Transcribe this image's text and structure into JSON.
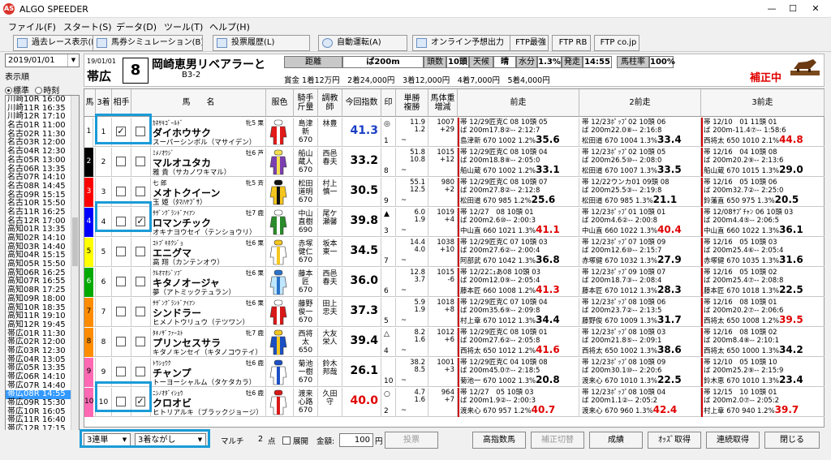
{
  "titlebar": {
    "app_icon": "AS",
    "title": "ALGO SPEEDER",
    "minimize": "—",
    "maximize": "☐",
    "close": "✕"
  },
  "menu": [
    "ファイル(F)",
    "スタート(S)",
    "データ(D)",
    "ツール(T)",
    "ヘルプ(H)"
  ],
  "toolbar": [
    {
      "label": "過去レース表示(K)",
      "icon": "magnifier-icon"
    },
    {
      "label": "馬券シミュレーション(B)",
      "icon": "simulation-icon"
    },
    {
      "label": "投票履歴(L)",
      "icon": "history-icon"
    },
    {
      "label": "自動運転(A)",
      "icon": "autorun-icon"
    },
    {
      "label": "オンライン予想出力",
      "icon": "online-icon"
    },
    {
      "label": "FTP最強",
      "icon": ""
    },
    {
      "label": "FTP RB",
      "icon": ""
    },
    {
      "label": "FTP co.jp",
      "icon": ""
    }
  ],
  "left": {
    "date": "2019/01/01",
    "order_label": "表示順",
    "order_options": [
      "標準",
      "時刻"
    ],
    "order_selected": 0,
    "races": [
      "川崎10R 16:00",
      "川崎11R 16:35",
      "川崎12R 17:10",
      "名古01R 11:00",
      "名古02R 11:30",
      "名古03R 12:00",
      "名古04R 12:30",
      "名古05R 13:00",
      "名古06R 13:35",
      "名古07R 14:10",
      "名古08R 14:45",
      "名古09R 15:15",
      "名古10R 15:50",
      "名古11R 16:25",
      "名古12R 17:00",
      "高知01R 13:35",
      "高知02R 14:10",
      "高知03R 14:40",
      "高知04R 15:15",
      "高知05R 15:50",
      "高知06R 16:25",
      "高知07R 16:55",
      "高知08R 17:25",
      "高知09R 18:00",
      "高知10R 18:35",
      "高知11R 19:10",
      "高知12R 19:45",
      "帯広01R 11:30",
      "帯広02R 12:00",
      "帯広03R 12:30",
      "帯広04R 13:05",
      "帯広05R 13:35",
      "帯広06R 14:10",
      "帯広07R 14:40",
      "帯広08R 14:55",
      "帯広09R 15:30",
      "帯広10R 16:05",
      "帯広11R 16:40",
      "帯広12R 17:15"
    ],
    "selected": 34
  },
  "race": {
    "date": "19/01/01",
    "venue": "帯広",
    "number": "8",
    "name": "岡崎恵男リベアラーと",
    "class": "B3-2",
    "distance_label": "距離",
    "distance": "ば200m",
    "heads_label": "頭数",
    "heads": "10頭",
    "weather_label": "天候",
    "weather": "晴",
    "moisture_label": "水分",
    "moisture": "1.3%",
    "start_label": "発走",
    "start": "14:55",
    "horse_rate_label": "馬柱率",
    "horse_rate": "100%",
    "prize": "賞金 1着12万円　2着24,000円　3着12,000円　4着7,000円　5着4,000円",
    "hosei": "補正中"
  },
  "columns": [
    "馬",
    "3着",
    "相手",
    "馬　　名",
    "服色",
    "騎手\n斤量",
    "調教\n師",
    "今回指数",
    "印",
    "単勝\n複勝",
    "馬体重\n増減",
    "前走",
    "2前走",
    "3前走"
  ],
  "horses": [
    {
      "gate_color": "#ffffff",
      "no": "1",
      "idx": "1",
      "c3": true,
      "partner": false,
      "sire": "ｶﾈｻｷｺﾞｰﾙﾄﾞ",
      "name": "ダイホウサク",
      "dam": "スーパーシンボル（マサイデン）",
      "sexage": "牝5 栗",
      "silk": "red",
      "jockey": "島津\n新\n670",
      "trainer": "林豊",
      "index": "41.3",
      "index_color": "#1a3fc4",
      "mark": "◎",
      "pop": "1",
      "odds": "11.9\n1.2",
      "weight": "1007\n+29",
      "p1": [
        "帯 12/29匠克C 08 10頭 05",
        "ば 200m17.8②-- 2:12:7",
        "島津新 670 1002 1.2%35.6"
      ],
      "p2": [
        "帯 12/23ﾎﾟｯﾌﾟ02 10頭 06",
        "ば 200m22.0⑧-- 2:16:8",
        "松田道 670 1004 1.3%33.4"
      ],
      "p3": [
        "帯 12/10　01 11頭 01",
        "ば 200m-11.4⑦-- 1:58:6",
        "西将太 650 1010 2.1%44.8"
      ]
    },
    {
      "gate_color": "#000000",
      "no": "2",
      "idx": "2",
      "c3": false,
      "partner": false,
      "sire": "ﾐﾒﾉｵｳｼﾞ",
      "name": "マルオユタカ",
      "dam": "雅 貴（サカノワキマル）",
      "sexage": "牡6 芦",
      "silk": "purple",
      "jockey": "船山\n蔵人\n670",
      "trainer": "西邑\n春夫",
      "index": "33.2",
      "index_color": "#000000",
      "mark": "",
      "pop": "8",
      "odds": "51.8\n10.8",
      "weight": "1015\n+12",
      "p1": [
        "帯 12/29匠克C 08 10頭 04",
        "ば 200m18.8⑧-- 2:05:0",
        "船山蔵 670 1002 1.2%33.1"
      ],
      "p2": [
        "帯 12/23ﾎﾟｯﾌﾟ02 10頭 05",
        "ば 200m26.5⑩-- 2:08:0",
        "松田道 670 1007 1.3%33.5"
      ],
      "p3": [
        "帯 12/16　04 10頭 08",
        "ば 200m20.2⑨-- 2:13:6",
        "船山蔵 670 1015 1.3%29.0"
      ]
    },
    {
      "gate_color": "#ff0000",
      "no": "3",
      "idx": "3",
      "c3": false,
      "partner": false,
      "sire": "七 郎",
      "name": "メオトクイーン",
      "dam": "玉 姫（ﾀﾏﾊﾔﾌﾞｻ）",
      "sexage": "牝5 斉",
      "silk": "yellow",
      "jockey": "松田\n道明\n670",
      "trainer": "村上\n慎一",
      "index": "30.5",
      "index_color": "#000000",
      "mark": "",
      "pop": "9",
      "odds": "55.1\n12.5",
      "weight": "980\n+2",
      "p1": [
        "帯 12/29匠克C 08 10頭 07",
        "ば 200m27.8②-- 2:12:8",
        "松田道 670 985 1.2%25.6"
      ],
      "p2": [
        "帯 12/22ウンカ01 09頭 08",
        "ば 200m25.5③-- 2:19:8",
        "松田道 670 985 1.3%21.1"
      ],
      "p3": [
        "帯 12/16　05 10頭 06",
        "ば 200m32.7②-- 2:25:0",
        "鈴藩直 650 975 1.3%20.5"
      ]
    },
    {
      "gate_color": "#0000ff",
      "no": "4",
      "idx": "4",
      "c3": false,
      "partner": true,
      "sire": "ｻｻﾞﾝｸﾞﾗﾝﾄﾞｱｲｱﾝ",
      "name": "ロマンチック",
      "dam": "オキナヨウセイ（テンショウリ）",
      "sexage": "牡7 鹿",
      "silk": "green",
      "jockey": "中山\n直樹\n690",
      "trainer": "尾ケ\n瀬馨",
      "index": "39.8",
      "index_color": "#000000",
      "mark": "▲",
      "pop": "3",
      "odds": "6.0\n1.9",
      "weight": "1019\n+4",
      "p1": [
        "帯 12/27　08 10頭 01",
        "ば 200m2.6⑩-- 2:00:3",
        "中山直 660 1021 1.3%41.1"
      ],
      "p2": [
        "帯 12/23ﾎﾟｯﾌﾟ01 10頭 01",
        "ば 200m4.6②-- 2:00:8",
        "中山直 660 1022 1.3%40.4"
      ],
      "p3": [
        "帯 12/08ｻﾌﾟﾁｬﾝ 06 10頭 03",
        "ば 200m4.4⑤-- 2:06:5",
        "中山直 660 1022 1.3%36.1"
      ]
    },
    {
      "gate_color": "#ffff00",
      "no": "5",
      "idx": "5",
      "c3": false,
      "partner": false,
      "sire": "ｺﾄﾌﾞｷﾎｸｼﾞｮ",
      "name": "エニグマ",
      "dam": "高 翔（カンテンオウ）",
      "sexage": "牡6 栗",
      "silk": "white",
      "jockey": "赤塚\n健仁\n670",
      "trainer": "坂本\n東一",
      "index": "34.5",
      "index_color": "#000000",
      "mark": "",
      "pop": "7",
      "odds": "14.4\n4.0",
      "weight": "1038\n+10",
      "p1": [
        "帯 12/29匠克C 07 10頭 03",
        "ば 200m27.6②-- 2:00:4",
        "阿部武 670 1042 1.3%36.8"
      ],
      "p2": [
        "帯 12/23ﾎﾟｯﾌﾟ07 10頭 09",
        "ば 200m12.6⑩-- 2:15:7",
        "赤塚健 670 1032 1.3%27.9"
      ],
      "p3": [
        "帯 12/16　05 10頭 03",
        "ば 200m25.4⑥-- 2:05:4",
        "赤塚健 670 1035 1.3%31.6"
      ]
    },
    {
      "gate_color": "#00aa00",
      "no": "6",
      "idx": "6",
      "c3": false,
      "partner": false,
      "sire": "ｸﾙｵﾏｵｼﾞｿﾌﾞ",
      "name": "キタノオージャ",
      "dam": "夢（アトミックテュラン）",
      "sexage": "牡6 栗",
      "silk": "lightblue",
      "jockey": "藤本\n匠\n670",
      "trainer": "西邑\n春夫",
      "index": "36.0",
      "index_color": "#000000",
      "mark": "",
      "pop": "6",
      "odds": "12.8\n3.7",
      "weight": "1015\n-6",
      "p1": [
        "帯 12/22ﾆｭあ08 10頭 03",
        "ば 200m12.0⑨-- 2:05:4",
        "藤本匠 660 1008 1.2%41.3"
      ],
      "p2": [
        "帯 12/23ﾎﾟｯﾌﾟ09 10頭 07",
        "ば 200m18.7③-- 2:08:4",
        "藤本匠 670 1012 1.3%28.3"
      ],
      "p3": [
        "帯 12/16　05 10頭 02",
        "ば 200m25.4⑦-- 2:08:8",
        "藤本匠 670 1018 1.3%22.5"
      ]
    },
    {
      "gate_color": "#ff8c00",
      "no": "7",
      "idx": "7",
      "c3": false,
      "partner": false,
      "sire": "ｻｻﾞﾝｸﾞﾗﾝﾄﾞｱｲｱﾝ",
      "name": "シンドラー",
      "dam": "ヒメノトウリュウ（テツワン）",
      "sexage": "牡6 栗",
      "silk": "red2",
      "jockey": "藤野\n俊一\n670",
      "trainer": "田上\n忠夫",
      "index": "37.3",
      "index_color": "#000000",
      "mark": "",
      "pop": "5",
      "odds": "5.9\n1.9",
      "weight": "1018\n+8",
      "p1": [
        "帯 12/29匠克C 07 10頭 04",
        "ば 200m35.6⑨-- 2:09:8",
        "村上章 670 1012 1.3%34.4"
      ],
      "p2": [
        "帯 12/23ﾎﾟｯﾌﾟ08 10頭 06",
        "ば 200m23.7②-- 2:13:5",
        "藤野俊 670 1009 1.3%31.7"
      ],
      "p3": [
        "帯 12/16　08 10頭 01",
        "ば 200m20.2⑦-- 2:06:6",
        "西将太 650 1008 1.2%39.5"
      ]
    },
    {
      "gate_color": "#ff8c00",
      "no": "8",
      "idx": "8",
      "c3": false,
      "partner": false,
      "sire": "ﾀｷﾉｻﾞﾌｧｰｽﾄ",
      "name": "プリンセスサラ",
      "dam": "キタノキンセイ（キタノコウテイ）",
      "sexage": "牝7 鹿",
      "silk": "blue",
      "jockey": "西将\n太\n650",
      "trainer": "大友\n栄人",
      "index": "39.4",
      "index_color": "#000000",
      "mark": "△",
      "pop": "4",
      "odds": "8.2\n1.6",
      "weight": "1012\n+6",
      "p1": [
        "帯 12/29匠克C 08 10頭 01",
        "ば 200m27.6②-- 2:05:8",
        "西将太 650 1012 1.2%41.6"
      ],
      "p2": [
        "帯 12/23ﾎﾟｯﾌﾟ08 10頭 03",
        "ば 200m21.8⑤-- 2:09:1",
        "西将太 650 1002 1.3%38.6"
      ],
      "p3": [
        "帯 12/16　08 10頭 02",
        "ば 200m8.4⑧-- 2:10:1",
        "西将太 650 1000 1.3%34.2"
      ]
    },
    {
      "gate_color": "#ff69b4",
      "no": "9",
      "idx": "9",
      "c3": false,
      "partner": false,
      "sire": "ﾄｳｼｮｳｸ",
      "name": "チャンプ",
      "dam": "トーヨーシャルム（タケタカラ）",
      "sexage": "牡6 鹿",
      "silk": "bluewhite",
      "jockey": "菊池\n一樹\n670",
      "trainer": "鈴木\n邦哉",
      "index": "26.1",
      "index_color": "#000000",
      "mark": "",
      "pop": "10",
      "odds": "38.2\n8.5",
      "weight": "1001\n+3",
      "p1": [
        "帯 12/29匠克C 04 10頭 08",
        "ば 200m45.0⑦-- 2:18:5",
        "菊池一 670 1002 1.3%20.8"
      ],
      "p2": [
        "帯 12/23ﾎﾟｯﾌﾟ08 10頭 09",
        "ば 200m30.1⑩-- 2:20:6",
        "渡来心 670 1010 1.3%22.5"
      ],
      "p3": [
        "帯 12/10　05 10頭 10",
        "ば 200m25.2⑨-- 2:15:9",
        "鈴木恵 670 1010 1.3%23.4"
      ]
    },
    {
      "gate_color": "#ff69b4",
      "no": "10",
      "idx": "10",
      "c3": false,
      "partner": true,
      "sire": "ﾆｼﾉｵﾀﾞｲｼｮｳ",
      "name": "クロオビ",
      "dam": "ヒトリアルキ（ブラックジョージ）",
      "sexage": "牡6 鹿",
      "silk": "redwhite",
      "jockey": "渡来\n心路\n670",
      "trainer": "久田\n守",
      "index": "40.0",
      "index_color": "#e00000",
      "mark": "○",
      "pop": "2",
      "odds": "4.7\n1.6",
      "weight": "964\n+7",
      "p1": [
        "帯 12/27　05 10頭 03",
        "ば 200m1.9②-- 2:00:3",
        "渡来心 670 957 1.2%40.7"
      ],
      "p2": [
        "帯 12/23ﾎﾟｯﾌﾟ08 10頭 04",
        "ば 200m1.1②-- 2:05:2",
        "渡来心 670 960 1.3%42.4"
      ],
      "p3": [
        "帯 12/15　10 10頭 01",
        "ば 200m2.0⑦-- 2:05:2",
        "村上章 670 940 1.2%39.7"
      ]
    }
  ],
  "bottom": {
    "bet_type": "3連単",
    "bet_method": "3着ながし",
    "multi_label": "マルチ",
    "points": "2",
    "points_unit": "点",
    "expand_label": "展開",
    "amount_label": "金額:",
    "amount": "100",
    "amount_unit": "円",
    "vote": "投票",
    "buttons": [
      "高指数馬",
      "補正切替",
      "成績",
      "ｵｯｽﾞ取得",
      "連続取得",
      "閉じる"
    ]
  }
}
